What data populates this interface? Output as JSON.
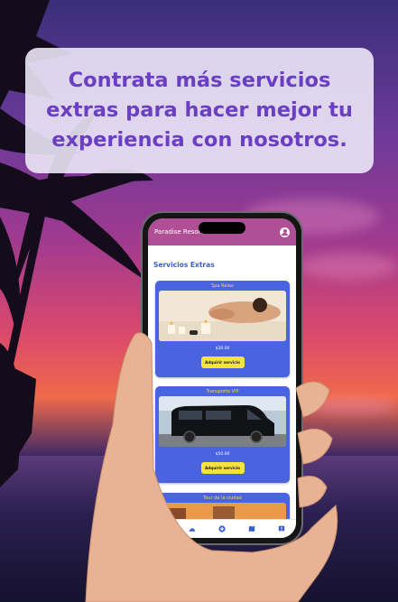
{
  "headline": "Contrata más servicios extras para hacer mejor tu experiencia con nosotros.",
  "app": {
    "title": "Paradise Resort",
    "account_icon": "account-circle-icon",
    "section_title": "Servicios Extras",
    "accent_color": "#b04f96",
    "card_color": "#4a63e0",
    "button_color": "#f6e43a"
  },
  "services": [
    {
      "name": "Spa Relax",
      "price": "$30.00",
      "button": "Adquirir servicio",
      "image": "spa-massage-photo"
    },
    {
      "name": "Transporte VIP",
      "price": "$50.00",
      "button": "Adquirir servicio",
      "image": "black-van-photo"
    },
    {
      "name": "Tour de la ciudad",
      "image": "city-tour-photo"
    }
  ],
  "bottom_nav": [
    {
      "icon": "home-icon"
    },
    {
      "icon": "services-icon"
    },
    {
      "icon": "add-icon"
    },
    {
      "icon": "map-icon"
    },
    {
      "icon": "info-icon"
    }
  ]
}
